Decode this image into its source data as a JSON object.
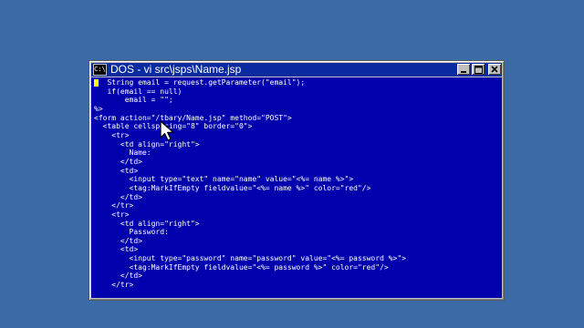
{
  "window": {
    "title": "DOS - vi src\\jsps\\Name.jsp",
    "icon": "dos-console-icon",
    "title_bar_color": "#0a2aa0",
    "console_bg": "#0000ac",
    "text_color": "#ffffff",
    "desktop_color": "#3b6ba6"
  },
  "editor": {
    "lines": [
      "   String email = request.getParameter(\"email\");",
      "   if(email == null)",
      "       email = \"\";",
      "%>",
      "<form action=\"/tbary/Name.jsp\" method=\"POST\">",
      "  <table cellspacing=\"8\" border=\"0\">",
      "    <tr>",
      "      <td align=\"right\">",
      "        Name:",
      "      </td>",
      "      <td>",
      "        <input type=\"text\" name=\"name\" value=\"<%= name %>\">",
      "        <tag:MarkIfEmpty fieldvalue=\"<%= name %>\" color=\"red\"/>",
      "      </td>",
      "    </tr>",
      "    <tr>",
      "      <td align=\"right\">",
      "        Password:",
      "      </td>",
      "      <td>",
      "        <input type=\"password\" name=\"password\" value=\"<%= password %>\">",
      "        <tag:MarkIfEmpty fieldvalue=\"<%= password %>\" color=\"red\"/>",
      "      </td>",
      "    </tr>"
    ]
  }
}
